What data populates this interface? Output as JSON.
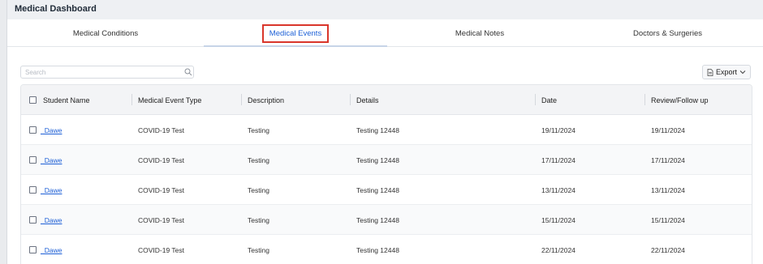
{
  "header": {
    "title": "Medical Dashboard"
  },
  "tabs": [
    {
      "label": "Medical Conditions"
    },
    {
      "label": "Medical Events"
    },
    {
      "label": "Medical Notes"
    },
    {
      "label": "Doctors & Surgeries"
    }
  ],
  "active_tab": "Medical Events",
  "search": {
    "placeholder": "Search",
    "value": ""
  },
  "export": {
    "label": "Export"
  },
  "table": {
    "columns": [
      "Student Name",
      "Medical Event Type",
      "Description",
      "Details",
      "Date",
      "Review/Follow up"
    ],
    "rows": [
      {
        "student": "_Dawe",
        "type": "COVID-19 Test",
        "description": "Testing",
        "details": "Testing 12448",
        "date": "19/11/2024",
        "review": "19/11/2024"
      },
      {
        "student": "_Dawe",
        "type": "COVID-19 Test",
        "description": "Testing",
        "details": "Testing 12448",
        "date": "17/11/2024",
        "review": "17/11/2024"
      },
      {
        "student": "_Dawe",
        "type": "COVID-19 Test",
        "description": "Testing",
        "details": "Testing 12448",
        "date": "13/11/2024",
        "review": "13/11/2024"
      },
      {
        "student": "_Dawe",
        "type": "COVID-19 Test",
        "description": "Testing",
        "details": "Testing 12448",
        "date": "15/11/2024",
        "review": "15/11/2024"
      },
      {
        "student": "_Dawe",
        "type": "COVID-19 Test",
        "description": "Testing",
        "details": "Testing 12448",
        "date": "22/11/2024",
        "review": "22/11/2024"
      }
    ]
  }
}
